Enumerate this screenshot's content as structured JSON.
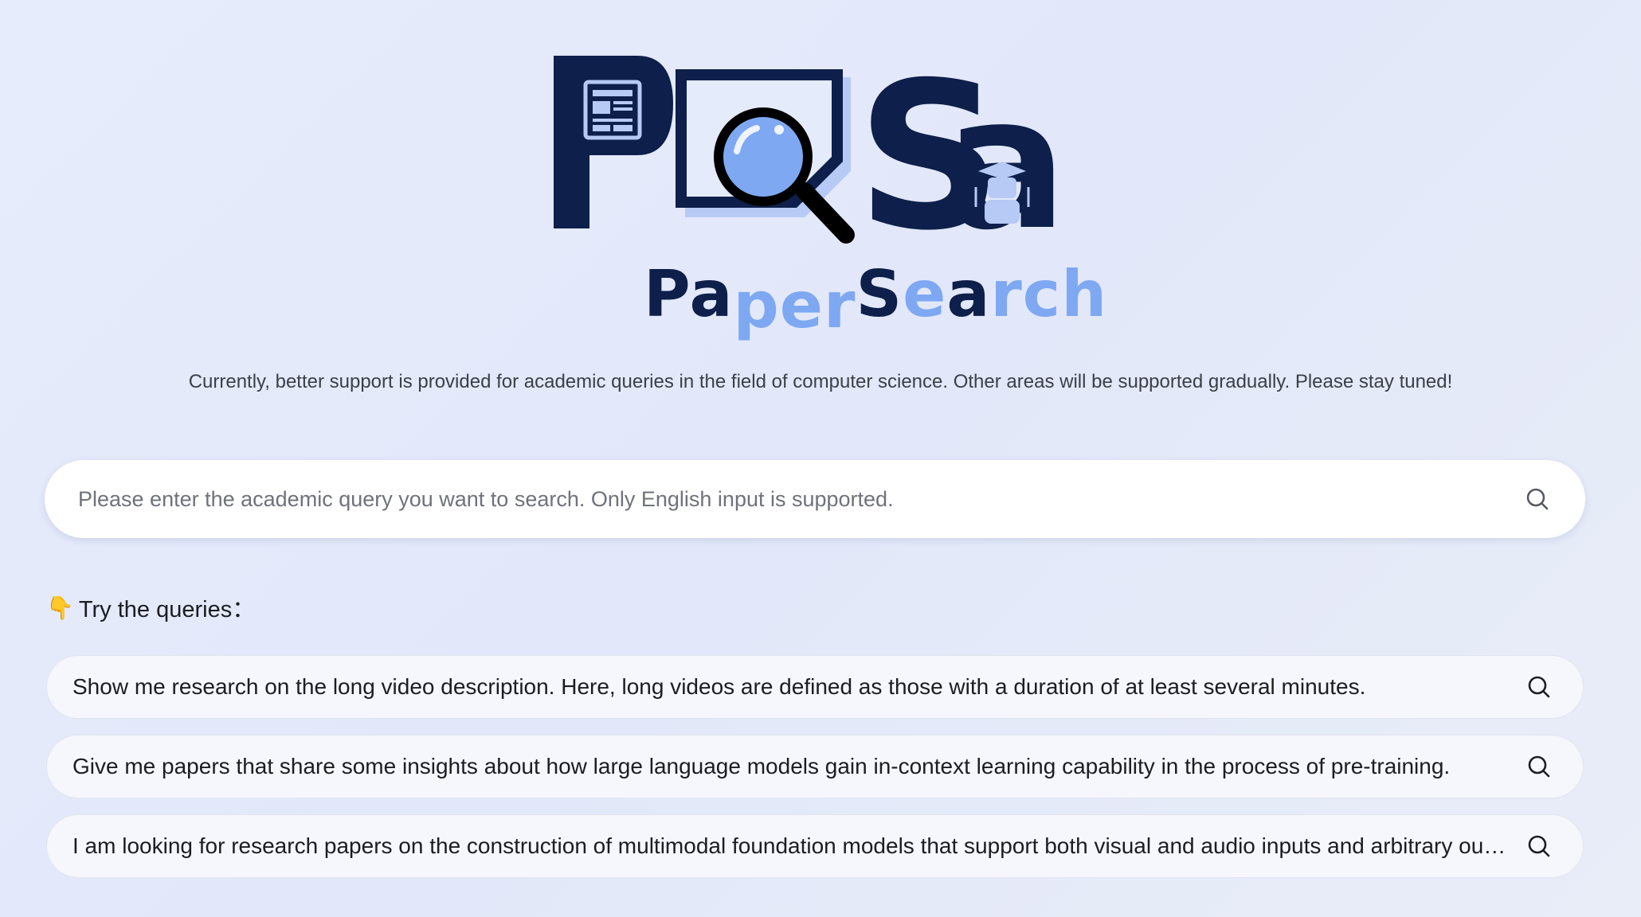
{
  "logo": {
    "letters": "PaSa",
    "name_parts": [
      {
        "text": "Pa",
        "tone": "dark"
      },
      {
        "text": "per",
        "tone": "light"
      },
      {
        "text": "S",
        "tone": "dark"
      },
      {
        "text": "e",
        "tone": "light"
      },
      {
        "text": "a",
        "tone": "dark"
      },
      {
        "text": "rch",
        "tone": "light"
      }
    ],
    "icons": [
      "newspaper-icon",
      "magnifier-icon",
      "graduate-robot-icon"
    ],
    "colors": {
      "dark": "#0d1f4a",
      "light": "#7ea8f2",
      "pale": "#b7c9f5"
    }
  },
  "subtitle": "Currently, better support is provided for academic queries in the field of computer science. Other areas will be supported gradually. Please stay tuned!",
  "search": {
    "placeholder": "Please enter the academic query you want to search. Only English input is supported.",
    "value": "",
    "icon": "search-icon"
  },
  "try_section": {
    "icon": "👇",
    "label": "Try the queries："
  },
  "queries": [
    {
      "text": "Show me research on the long video description. Here, long videos are defined as those with a duration of at least several minutes.",
      "icon": "search-icon"
    },
    {
      "text": "Give me papers that share some insights about how large language models gain in-context learning capability in the process of pre-training.",
      "icon": "search-icon"
    },
    {
      "text": "I am looking for research papers on the construction of multimodal foundation models that support both visual and audio inputs and arbitrary outputs.",
      "icon": "search-icon"
    }
  ]
}
